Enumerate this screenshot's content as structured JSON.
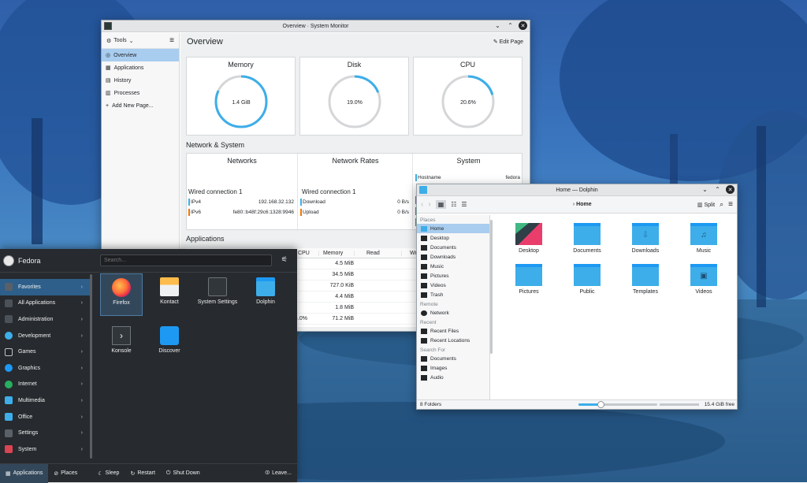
{
  "system_monitor": {
    "title": "Overview · System Monitor",
    "tools_label": "Tools",
    "nav": [
      "Overview",
      "Applications",
      "History",
      "Processes",
      "Add New Page..."
    ],
    "page_title": "Overview",
    "edit_page_label": "Edit Page",
    "memory": {
      "title": "Memory",
      "value": "1.4 GiB",
      "fraction": 0.82
    },
    "disk": {
      "title": "Disk",
      "value": "19.0%",
      "fraction": 0.19
    },
    "cpu": {
      "title": "CPU",
      "value": "20.6%",
      "fraction": 0.206
    },
    "network_section_title": "Network & System",
    "networks_title": "Networks",
    "network_rates_title": "Network Rates",
    "system_title": "System",
    "wired_connection": "Wired connection 1",
    "ipv4_label": "IPv4",
    "ipv4_value": "192.168.32.132",
    "ipv6_label": "IPv6",
    "ipv6_value": "fe80::b48f:29c6:1328:9946",
    "download_label": "Download",
    "download_value": "0 B/s",
    "upload_label": "Upload",
    "upload_value": "0 B/s",
    "hostname_label": "Hostname",
    "hostname_value": "fedora",
    "applications_section_title": "Applications",
    "table_headers": [
      "CPU",
      "Memory",
      "Read",
      "Writ"
    ],
    "table_rows": [
      {
        "cpu": "",
        "mem": "4.5 MiB"
      },
      {
        "cpu": "",
        "mem": "34.5 MiB"
      },
      {
        "cpu": "",
        "mem": "727.0 KiB"
      },
      {
        "cpu": "",
        "mem": "4.4 MiB"
      },
      {
        "cpu": "",
        "mem": "1.8 MiB"
      },
      {
        "cpu": "4.0%",
        "mem": "71.2 MiB"
      }
    ]
  },
  "dolphin": {
    "title": "Home — Dolphin",
    "breadcrumb": "Home",
    "split_label": "Split",
    "places_header": "Places",
    "places": [
      "Home",
      "Desktop",
      "Documents",
      "Downloads",
      "Music",
      "Pictures",
      "Videos",
      "Trash"
    ],
    "remote_header": "Remote",
    "remote": [
      "Network"
    ],
    "recent_header": "Recent",
    "recent": [
      "Recent Files",
      "Recent Locations"
    ],
    "search_header": "Search For",
    "search": [
      "Documents",
      "Images",
      "Audio"
    ],
    "files": [
      "Desktop",
      "Documents",
      "Downloads",
      "Music",
      "Pictures",
      "Public",
      "Templates",
      "Videos"
    ],
    "status_count": "8 Folders",
    "status_free": "15.4 GiB free",
    "zoom_fraction": 0.28,
    "accent": "#3daee9"
  },
  "launcher": {
    "user_name": "Fedora",
    "search_placeholder": "Search...",
    "categories": [
      "Favorites",
      "All Applications",
      "Administration",
      "Development",
      "Games",
      "Graphics",
      "Internet",
      "Multimedia",
      "Office",
      "Settings",
      "System"
    ],
    "apps": [
      "Firefox",
      "Kontact",
      "System Settings",
      "Dolphin",
      "Konsole",
      "Discover"
    ],
    "footer": {
      "applications": "Applications",
      "places": "Places",
      "sleep": "Sleep",
      "restart": "Restart",
      "shutdown": "Shut Down",
      "leave": "Leave..."
    }
  }
}
